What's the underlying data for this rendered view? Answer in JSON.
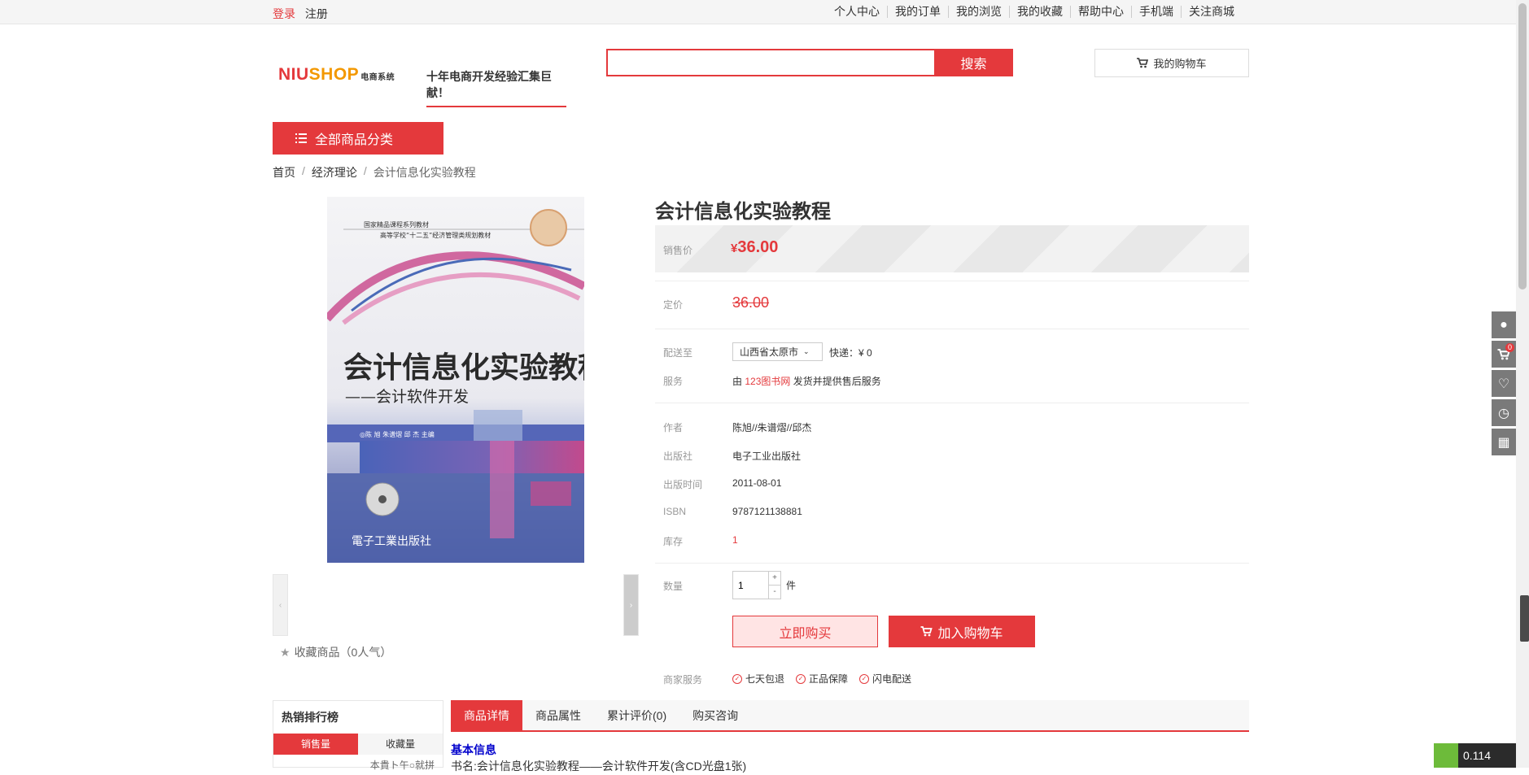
{
  "topbar": {
    "login": "登录",
    "register": "注册",
    "links": [
      "个人中心",
      "我的订单",
      "我的浏览",
      "我的收藏",
      "帮助中心",
      "手机端",
      "关注商城"
    ]
  },
  "header": {
    "logo_niu": "NIU",
    "logo_shop": "SHOP",
    "logo_sys": "电商系统",
    "slogan": "十年电商开发经验汇集巨献！",
    "search_value": "",
    "search_button": "搜索",
    "cart_button": "我的购物车"
  },
  "category_button": "全部商品分类",
  "breadcrumb": {
    "home": "首页",
    "category": "经济理论",
    "current": "会计信息化实验教程"
  },
  "gallery": {
    "cover_top1": "国家精品课程系列教材",
    "cover_top2": "高等学校“十二五”经济管理类规划教材",
    "cover_title": "会计信息化实验教程",
    "cover_subtitle": "——会计软件开发",
    "cover_authors": "◎陈  旭  朱谱熠  邱  杰  主编",
    "cover_publisher": "電子工業出版社",
    "favorite": "收藏商品（0人气）"
  },
  "product": {
    "title": "会计信息化实验教程",
    "price_label": "销售价",
    "price_currency": "¥",
    "price": "36.00",
    "original_label": "定价",
    "original_price": "36.00",
    "ship_label": "配送至",
    "ship_region": "山西省太原市",
    "ship_fee": "快递：¥ 0",
    "service_label": "服务",
    "service_prefix": "由",
    "service_store": "123图书网",
    "service_suffix": "发货并提供售后服务",
    "author_label": "作者",
    "author": "陈旭//朱谱熠//邱杰",
    "publisher_label": "出版社",
    "publisher": "电子工业出版社",
    "pubdate_label": "出版时间",
    "pubdate": "2011-08-01",
    "isbn_label": "ISBN",
    "isbn": "9787121138881",
    "stock_label": "库存",
    "stock": "1",
    "qty_label": "数量",
    "qty": "1",
    "qty_unit": "件",
    "buy_now": "立即购买",
    "add_to_cart": "加入购物车",
    "merchant_label": "商家服务",
    "services": [
      "七天包退",
      "正品保障",
      "闪电配送"
    ]
  },
  "hot": {
    "title": "热销排行榜",
    "tab_sales": "销售量",
    "tab_fav": "收藏量",
    "item": "本貴ト午○就拼"
  },
  "tabs": [
    "商品详情",
    "商品属性",
    "累计评价(0)",
    "购买咨询"
  ],
  "detail": {
    "heading": "基本信息",
    "line": "书名:会计信息化实验教程——会计软件开发(含CD光盘1张)"
  },
  "sidebar": {
    "cart_count": "0"
  },
  "speed_value": "0.114"
}
